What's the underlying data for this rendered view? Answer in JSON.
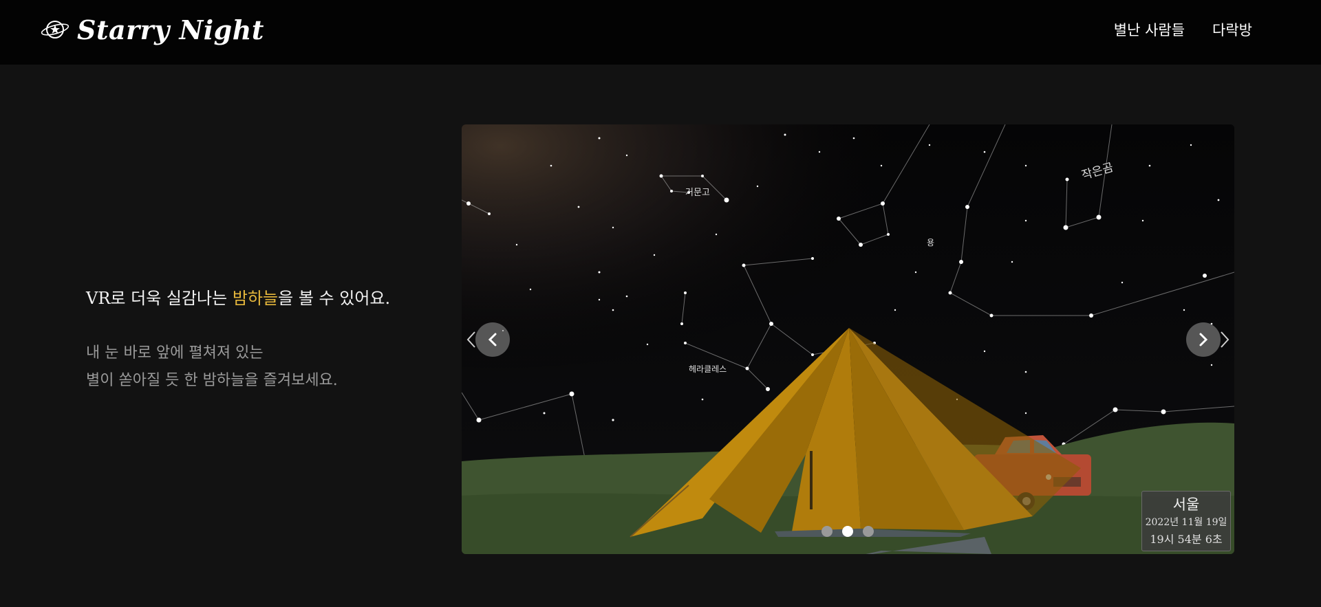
{
  "header": {
    "logo_text": "Starry Night",
    "nav": [
      {
        "label": "별난 사람들"
      },
      {
        "label": "다락방"
      }
    ]
  },
  "intro": {
    "headline_pre": "VR로 더욱 실감나는 ",
    "headline_accent": "밤하늘",
    "headline_post": "을 볼 수 있어요.",
    "desc_line1": "내 눈 바로 앞에 펼쳐져 있는",
    "desc_line2": "별이 쏟아질 듯 한 밤하늘을 즐겨보세요."
  },
  "carousel": {
    "constellation_labels": {
      "ursa_minor": "작은곰",
      "lyra": "거문고",
      "draco": "용",
      "hercules": "헤라클레스"
    },
    "slide_count": 3,
    "active_slide": 2,
    "info": {
      "city": "서울",
      "date": "2022년 11월 19일",
      "time": "19시 54분 6초"
    }
  },
  "colors": {
    "background": "#121212",
    "header": "#030303",
    "accent": "#e6b73c",
    "muted_text": "#9a9a9a",
    "tent": "#b8860b",
    "grass": "#3f5430",
    "car": "#c0533a"
  }
}
